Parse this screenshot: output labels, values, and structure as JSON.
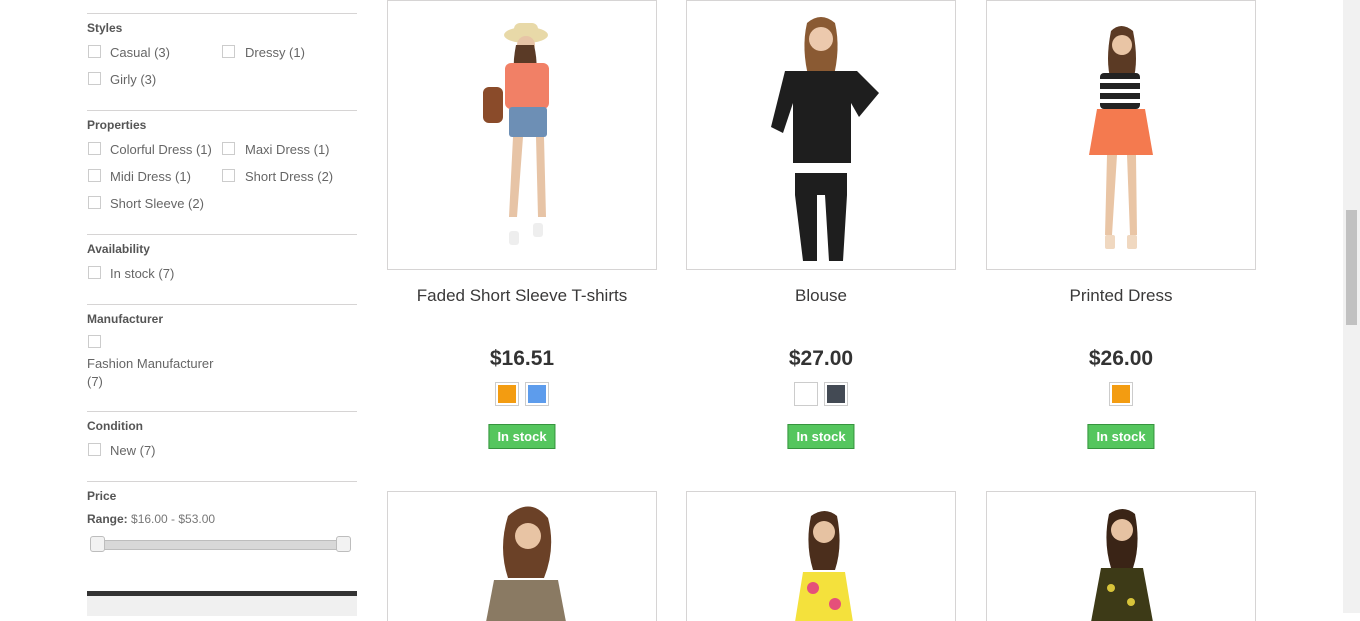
{
  "filters": {
    "styles": {
      "title": "Styles",
      "options": [
        {
          "label": "Casual (3)"
        },
        {
          "label": "Dressy (1)"
        },
        {
          "label": "Girly (3)"
        }
      ]
    },
    "properties": {
      "title": "Properties",
      "options": [
        {
          "label": "Colorful Dress (1)"
        },
        {
          "label": "Maxi Dress (1)"
        },
        {
          "label": "Midi Dress (1)"
        },
        {
          "label": "Short Dress (2)"
        },
        {
          "label": "Short Sleeve (2)"
        }
      ]
    },
    "availability": {
      "title": "Availability",
      "options": [
        {
          "label": "In stock (7)"
        }
      ]
    },
    "manufacturer": {
      "title": "Manufacturer",
      "options": [
        {
          "label_line1": "Fashion Manufacturer",
          "label_line2": "(7)"
        }
      ]
    },
    "condition": {
      "title": "Condition",
      "options": [
        {
          "label": "New (7)"
        }
      ]
    },
    "price": {
      "title": "Price",
      "range_label": "Range:",
      "range_value": "$16.00 - $53.00"
    }
  },
  "products": [
    {
      "name": "Faded Short Sleeve T-shirts",
      "price": "$16.51",
      "colors": [
        "#f39c11",
        "#5d9cec"
      ],
      "availability": "In stock"
    },
    {
      "name": "Blouse",
      "price": "$27.00",
      "colors": [
        "#ffffff",
        "#434a54"
      ],
      "availability": "In stock"
    },
    {
      "name": "Printed Dress",
      "price": "$26.00",
      "colors": [
        "#f39c11"
      ],
      "availability": "In stock"
    }
  ],
  "colors": {
    "in_stock_bg": "#55c65e",
    "border": "#d6d4d4"
  }
}
